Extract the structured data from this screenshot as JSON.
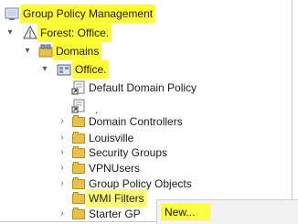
{
  "tree": {
    "root_label": "Group Policy Management",
    "forest_label": "Forest: Office.",
    "domains_label": "Domains",
    "office_label": "Office.",
    "items": [
      {
        "label": "Default Domain Policy",
        "icon": "gpo-link-icon"
      },
      {
        "label": ".",
        "icon": "gpo-link-icon"
      },
      {
        "label": "Domain Controllers",
        "icon": "ou-folder-icon"
      },
      {
        "label": "Louisville",
        "icon": "ou-folder-icon"
      },
      {
        "label": "Security Groups",
        "icon": "ou-folder-icon"
      },
      {
        "label": "VPNUsers",
        "icon": "ou-folder-icon"
      },
      {
        "label": "Group Policy Objects",
        "icon": "folder-icon"
      },
      {
        "label": "WMI Filters",
        "icon": "folder-icon"
      },
      {
        "label": "Starter GP",
        "icon": "folder-icon"
      }
    ]
  },
  "context_menu": {
    "new_label": "New..."
  },
  "colors": {
    "highlight": "#ffff33",
    "folder": "#e8c14b"
  }
}
